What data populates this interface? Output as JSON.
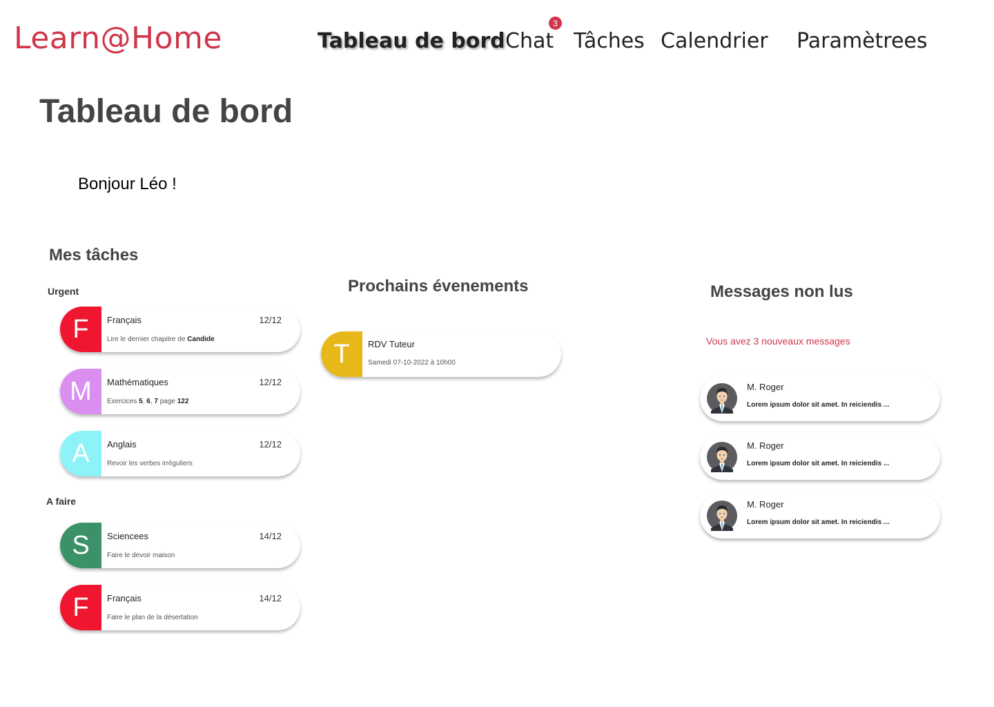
{
  "app": {
    "logo": "Learn@Home"
  },
  "nav": {
    "items": [
      {
        "label": "Tableau de bord",
        "active": true
      },
      {
        "label": "Chat",
        "badge": "3"
      },
      {
        "label": "Tâches"
      },
      {
        "label": "Calendrier"
      },
      {
        "label": "Paramètrees"
      }
    ]
  },
  "page": {
    "title": "Tableau de bord",
    "greeting": "Bonjour Léo !"
  },
  "tasks": {
    "title": "Mes tâches",
    "urgent_label": "Urgent",
    "todo_label": "A faire",
    "urgent": [
      {
        "letter": "F",
        "color": "#f0162f",
        "subject": "Français",
        "date": "12/12",
        "desc_parts": [
          {
            "t": "Lire le dernier chapitre de "
          },
          {
            "t": "Candide",
            "b": true
          }
        ]
      },
      {
        "letter": "M",
        "color": "#da8ff0",
        "subject": "Mathématiques",
        "date": "12/12",
        "desc_parts": [
          {
            "t": "Exercices "
          },
          {
            "t": "5",
            "b": true
          },
          {
            "t": ", "
          },
          {
            "t": "6",
            "b": true
          },
          {
            "t": ", "
          },
          {
            "t": "7",
            "b": true
          },
          {
            "t": " page "
          },
          {
            "t": "122",
            "b": true
          }
        ]
      },
      {
        "letter": "A",
        "color": "#8ef3f8",
        "subject": "Anglais",
        "date": "12/12",
        "desc_parts": [
          {
            "t": "Revoir les verbes irréguliers"
          }
        ]
      }
    ],
    "todo": [
      {
        "letter": "S",
        "color": "#3b9168",
        "subject": "Sciencees",
        "date": "14/12",
        "desc_parts": [
          {
            "t": "Faire le devoir maison"
          }
        ]
      },
      {
        "letter": "F",
        "color": "#f0162f",
        "subject": "Français",
        "date": "14/12",
        "desc_parts": [
          {
            "t": "Faire le plan de la désertation"
          }
        ]
      }
    ]
  },
  "events": {
    "title": "Prochains évenements",
    "items": [
      {
        "letter": "T",
        "color": "#e8b81a",
        "title": "RDV Tuteur",
        "desc": "Samedi 07-10-2022 à 10h00"
      }
    ]
  },
  "messages": {
    "title": "Messages non lus",
    "notice": "Vous avez 3 nouveaux messages",
    "items": [
      {
        "sender": "M. Roger",
        "preview": "Lorem ipsum dolor sit amet. In reiciendis ..."
      },
      {
        "sender": "M. Roger",
        "preview": "Lorem ipsum dolor sit amet. In reiciendis ..."
      },
      {
        "sender": "M. Roger",
        "preview": "Lorem ipsum dolor sit amet. In reiciendis ..."
      }
    ]
  }
}
